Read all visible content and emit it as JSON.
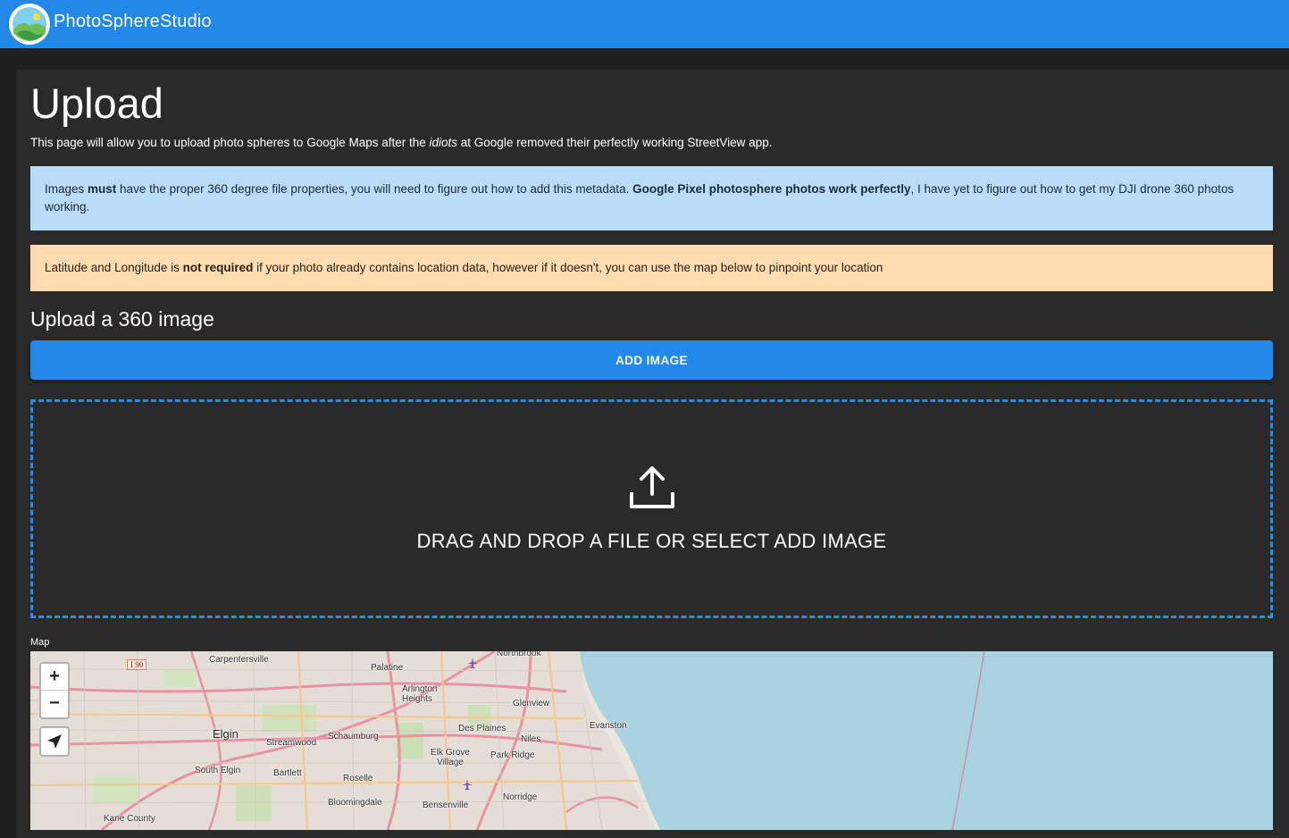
{
  "app": {
    "brand": "PhotoSphereStudio",
    "logo_icon": "photosphere-logo-icon",
    "accent": "#2289e8"
  },
  "page": {
    "title": "Upload",
    "intro_before": "This page will allow you to upload photo spheres to Google Maps after the ",
    "intro_emph": "idiots",
    "intro_after": " at Google removed their perfectly working StreetView app."
  },
  "info_alert": {
    "t1": "Images ",
    "b1": "must",
    "t2": " have the proper 360 degree file properties, you will need to figure out how to add this metadata. ",
    "b2": "Google Pixel photosphere photos work perfectly",
    "t3": ", I have yet to figure out how to get my DJI drone 360 photos working.",
    "color": "#b9dcf7"
  },
  "warn_alert": {
    "t1": "Latitude and Longitude is ",
    "b1": "not required",
    "t2": " if your photo already contains location data, however if it doesn't, you can use the map below to pinpoint your location",
    "color": "#fedcb0"
  },
  "upload": {
    "section_title": "Upload a 360 image",
    "add_button": "ADD IMAGE",
    "drop_icon": "upload-icon",
    "drop_text": "DRAG AND DROP A FILE OR SELECT ADD IMAGE"
  },
  "map": {
    "label": "Map",
    "zoom_in": "+",
    "zoom_out": "−",
    "locate_icon": "locate-arrow-icon",
    "highway_shield": "I 90",
    "places": [
      "Carpentersville",
      "Palatine",
      "Northbrook",
      "Arlington Heights",
      "Glenview",
      "Evanston",
      "Elgin",
      "Streamwood",
      "Schaumburg",
      "Des Plaines",
      "Niles",
      "Elk Grove Village",
      "Park Ridge",
      "South Elgin",
      "Bartlett",
      "Roselle",
      "Norridge",
      "Bloomingdale",
      "Bensenville",
      "Kane County"
    ]
  }
}
